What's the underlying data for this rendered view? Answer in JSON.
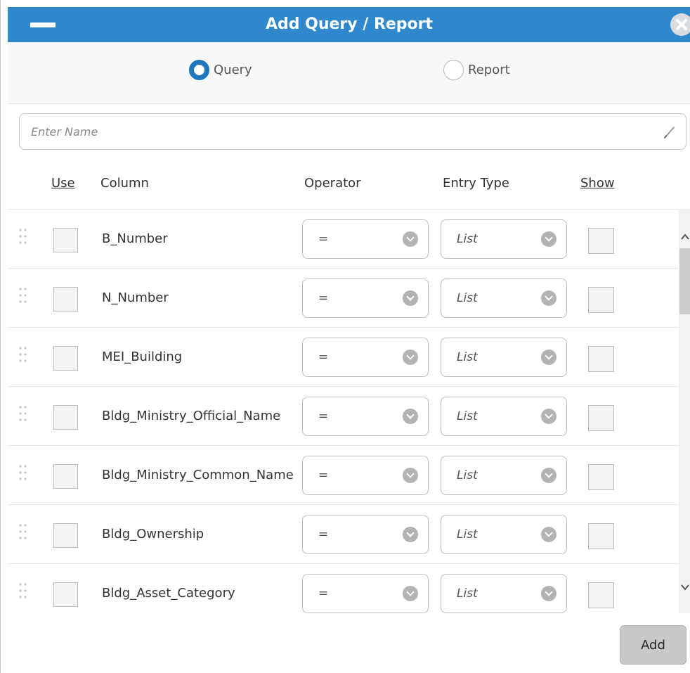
{
  "dialog": {
    "title": "Add Query / Report"
  },
  "type_selector": {
    "options": [
      {
        "label": "Query",
        "selected": true
      },
      {
        "label": "Report",
        "selected": false
      }
    ]
  },
  "name_input": {
    "value": "",
    "placeholder": "Enter Name"
  },
  "table": {
    "headers": {
      "use": "Use",
      "column": "Column",
      "operator": "Operator",
      "entry_type": "Entry Type",
      "show": "Show"
    },
    "rows": [
      {
        "column": "B_Number",
        "operator": "=",
        "entry_type": "List",
        "use": false,
        "show": false
      },
      {
        "column": "N_Number",
        "operator": "=",
        "entry_type": "List",
        "use": false,
        "show": false
      },
      {
        "column": "MEI_Building",
        "operator": "=",
        "entry_type": "List",
        "use": false,
        "show": false
      },
      {
        "column": "Bldg_Ministry_Official_Name",
        "operator": "=",
        "entry_type": "List",
        "use": false,
        "show": false
      },
      {
        "column": "Bldg_Ministry_Common_Name",
        "operator": "=",
        "entry_type": "List",
        "use": false,
        "show": false
      },
      {
        "column": "Bldg_Ownership",
        "operator": "=",
        "entry_type": "List",
        "use": false,
        "show": false
      },
      {
        "column": "Bldg_Asset_Category",
        "operator": "=",
        "entry_type": "List",
        "use": false,
        "show": false
      }
    ]
  },
  "footer": {
    "add_label": "Add"
  },
  "colors": {
    "titlebar": "#2f87cc",
    "radio_selected": "#1e76bd",
    "button": "#c9c9c9"
  },
  "icons": [
    "minimize-icon",
    "close-icon",
    "pencil-icon",
    "drag-handle-icon",
    "chevron-down-icon",
    "scroll-up-icon",
    "scroll-down-icon"
  ]
}
